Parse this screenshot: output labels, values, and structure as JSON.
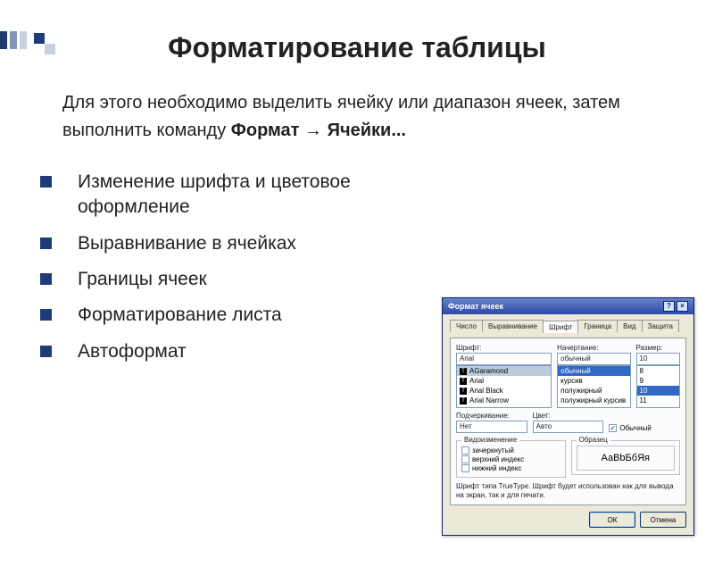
{
  "decoration": {
    "corner": "slide-corner-accent"
  },
  "title": "Форматирование таблицы",
  "intro": {
    "prefix": "Для этого необходимо выделить ячейку или диапазон ячеек, затем выполнить команду ",
    "menu_format": "Формат",
    "arrow": " → ",
    "menu_cells": "Ячейки..."
  },
  "bullets": [
    "Изменение шрифта и цветовое оформление",
    "Выравнивание в ячейках",
    "Границы ячеек",
    "Форматирование листа",
    "Автоформат"
  ],
  "dialog": {
    "title": "Формат ячеек",
    "help_btn": "?",
    "close_btn": "×",
    "tabs": [
      "Число",
      "Выравнивание",
      "Шрифт",
      "Граница",
      "Вид",
      "Защита"
    ],
    "active_tab_index": 2,
    "labels": {
      "font": "Шрифт:",
      "style": "Начертание:",
      "size": "Размер:",
      "underline": "Подчеркивание:",
      "color": "Цвет:",
      "normal_font": "Обычный",
      "effects_group": "Видоизменение",
      "strike": "зачеркнутый",
      "sup": "верхний индекс",
      "sub": "нижний индекс",
      "sample_group": "Образец",
      "hint": "Шрифт типа TrueType. Шрифт будет использован как для вывода на экран, так и для печати.",
      "ok": "ОК",
      "cancel": "Отмена"
    },
    "font": {
      "value": "Arial",
      "options": [
        "AGaramond",
        "Arial",
        "Arial Black",
        "Arial Narrow"
      ],
      "selected_index": 0
    },
    "style": {
      "value": "обычный",
      "options": [
        "обычный",
        "курсив",
        "полужирный",
        "полужирный курсив"
      ],
      "highlight_index": 0
    },
    "size": {
      "value": "10",
      "options": [
        "8",
        "9",
        "10",
        "11"
      ],
      "highlight_index": 2
    },
    "underline": {
      "value": "Нет"
    },
    "color": {
      "value": "Авто"
    },
    "normal_checked": true,
    "sample_text": "АаВbБбЯя"
  }
}
